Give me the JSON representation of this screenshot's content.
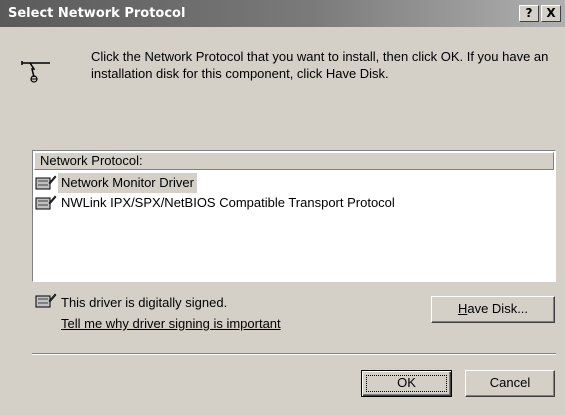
{
  "window": {
    "title": "Select Network Protocol",
    "help_label": "?",
    "close_label": "X"
  },
  "intro": {
    "text": "Click the Network Protocol that you want to install, then click OK. If you have an installation disk for this component, click Have Disk."
  },
  "protocol_list": {
    "header": "Network Protocol:",
    "items": [
      {
        "label": "Network Monitor Driver",
        "selected": true
      },
      {
        "label": "NWLink IPX/SPX/NetBIOS Compatible Transport Protocol",
        "selected": false
      }
    ]
  },
  "signature": {
    "status_text": "This driver is digitally signed.",
    "link_text": "Tell me why driver signing is important"
  },
  "buttons": {
    "have_disk": "Have Disk...",
    "have_disk_mnemonic": "H",
    "have_disk_rest": "ave Disk...",
    "ok": "OK",
    "cancel": "Cancel"
  },
  "icons": {
    "protocol": "network-protocol-icon",
    "driver": "signed-driver-icon"
  }
}
